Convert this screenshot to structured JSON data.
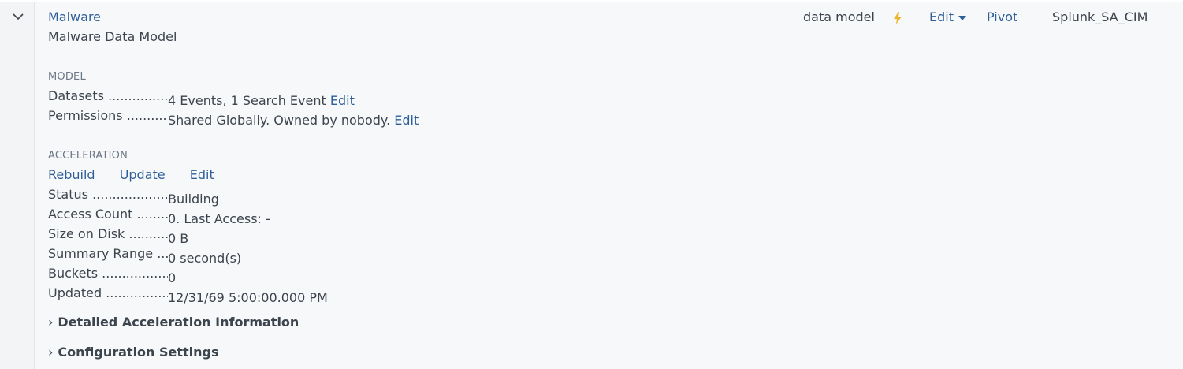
{
  "header": {
    "name": "Malware",
    "description": "Malware Data Model",
    "type": "data model",
    "edit_label": "Edit",
    "pivot_label": "Pivot",
    "app": "Splunk_SA_CIM"
  },
  "model": {
    "section_title": "MODEL",
    "datasets_label": "Datasets",
    "datasets_value": "4 Events, 1 Search Event",
    "datasets_edit": "Edit",
    "permissions_label": "Permissions",
    "permissions_value": "Shared Globally. Owned by nobody.",
    "permissions_edit": "Edit"
  },
  "acceleration": {
    "section_title": "ACCELERATION",
    "actions": {
      "rebuild": "Rebuild",
      "update": "Update",
      "edit": "Edit"
    },
    "fields": {
      "status_label": "Status",
      "status_value": "Building",
      "access_count_label": "Access Count",
      "access_count_value": "0. Last Access: -",
      "size_label": "Size on Disk",
      "size_value": "0 B",
      "summary_range_label": "Summary Range",
      "summary_range_value": "0 second(s)",
      "buckets_label": "Buckets",
      "buckets_value": "0",
      "updated_label": "Updated",
      "updated_value": "12/31/69 5:00:00.000 PM"
    }
  },
  "collapsibles": {
    "detailed": "Detailed Acceleration Information",
    "config": "Configuration Settings"
  },
  "colors": {
    "link": "#2f5f98",
    "accent_bolt": "#f0b429",
    "text": "#3c444d"
  },
  "icons": {
    "expand": "chevron-down-icon",
    "acceleration": "lightning-bolt-icon",
    "section_toggle": "chevron-right-icon"
  }
}
